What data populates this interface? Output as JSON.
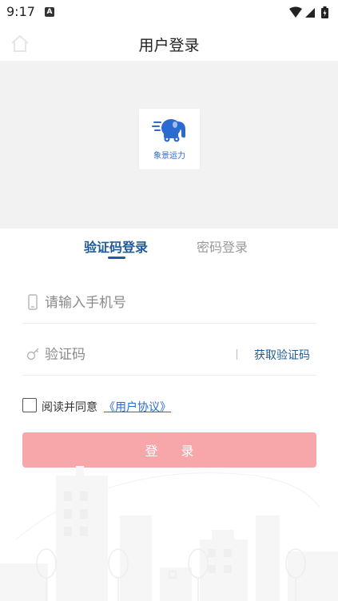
{
  "status_bar": {
    "time": "9:17",
    "notification_badge": "A",
    "icons": [
      "wifi-icon",
      "signal-icon",
      "battery-icon"
    ]
  },
  "nav": {
    "title": "用户登录",
    "home_icon": "home-icon"
  },
  "logo": {
    "caption": "象景运力",
    "icon": "elephant-truck-logo",
    "color": "#2a6ad1"
  },
  "tabs": [
    {
      "label": "验证码登录",
      "active": true
    },
    {
      "label": "密码登录",
      "active": false
    }
  ],
  "form": {
    "phone_placeholder": "请输入手机号",
    "phone_value": "",
    "code_placeholder": "验证码",
    "code_value": "",
    "get_code_label": "获取验证码"
  },
  "agreement": {
    "prefix": "阅读并同意",
    "link_label": "《用户协议》",
    "checked": false
  },
  "login_button": {
    "label": "登 录"
  },
  "colors": {
    "accent": "#1f5b99",
    "link": "#2a6ad1",
    "button_disabled": "#f7a6aa",
    "hero_bg": "#f2f2f2"
  }
}
